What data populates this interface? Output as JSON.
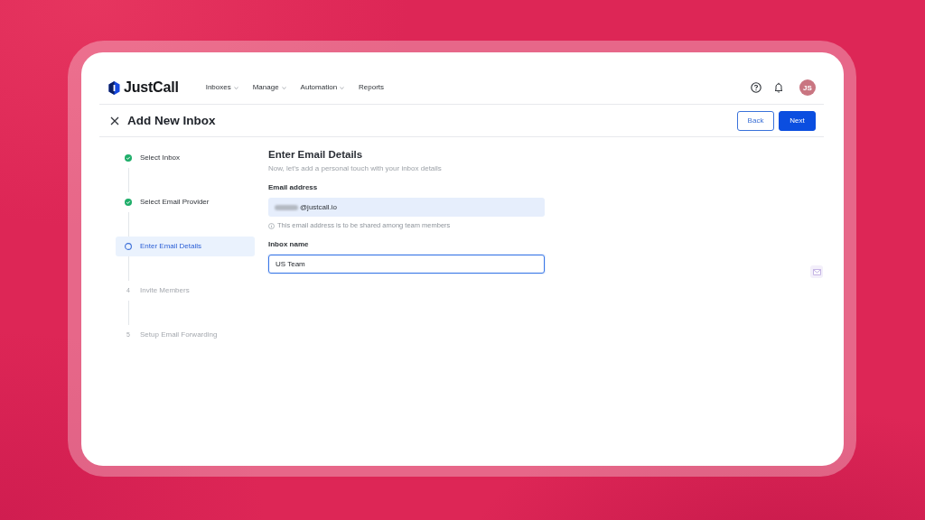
{
  "header": {
    "logo": "JustCall",
    "nav": [
      {
        "label": "Inboxes",
        "dropdown": true
      },
      {
        "label": "Manage",
        "dropdown": true
      },
      {
        "label": "Automation",
        "dropdown": true
      },
      {
        "label": "Reports",
        "dropdown": false
      }
    ],
    "avatar": "JS"
  },
  "page": {
    "title": "Add New Inbox",
    "buttons": [
      {
        "label": "Back",
        "kind": "secondary"
      },
      {
        "label": "Next",
        "kind": "primary"
      }
    ]
  },
  "steps": [
    {
      "label": "Select Inbox",
      "kind": "done",
      "selected": false
    },
    {
      "label": "Select Email Provider",
      "kind": "done",
      "selected": false
    },
    {
      "label": "Enter Email Details",
      "kind": "current",
      "selected": true
    },
    {
      "label": "Invite Members",
      "kind": "upcoming",
      "number": "4",
      "selected": false
    },
    {
      "label": "Setup Email Forwarding",
      "kind": "upcoming",
      "number": "5",
      "selected": false
    }
  ],
  "form": {
    "title": "Enter Email Details",
    "subtitle": "Now, let's add a personal touch with your inbox details",
    "email": {
      "label": "Email address",
      "value": "@justcall.io",
      "redacted": true,
      "hint": "This email address is to be shared among team members"
    },
    "inbox_name": {
      "label": "Inbox name",
      "value": "US Team",
      "focused": true
    }
  }
}
